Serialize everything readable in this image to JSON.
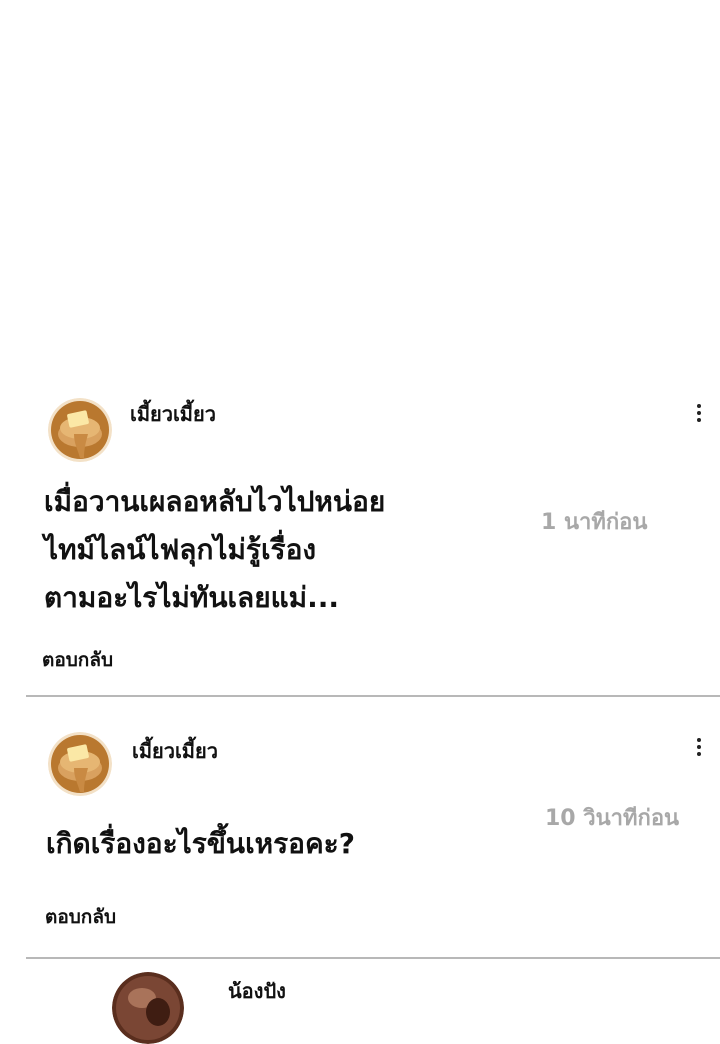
{
  "comments": [
    {
      "username": "เมี้ยวเมี้ยว",
      "lines": [
        "เมื่อวานเผลอหลับไวไปหน่อย",
        "ไทม์ไลน์ไฟลุกไม่รู้เรื่อง",
        "ตามอะไรไม่ทันเลยแม่..."
      ],
      "time": "1 นาทีก่อน",
      "reply": "ตอบกลับ",
      "avatar": "pancake-avatar-icon"
    },
    {
      "username": "เมี้ยวเมี้ยว",
      "lines": [
        "เกิดเรื่องอะไรขึ้นเหรอคะ?"
      ],
      "time": "10 วินาทีก่อน",
      "reply": "ตอบกลับ",
      "avatar": "pancake-avatar-icon"
    },
    {
      "username": "น้องปัง",
      "avatar": "photo-avatar"
    }
  ],
  "colors": {
    "time": "#a8a8a8",
    "divider": "#b8b8b8",
    "avatar_bg": "#b9782f"
  }
}
